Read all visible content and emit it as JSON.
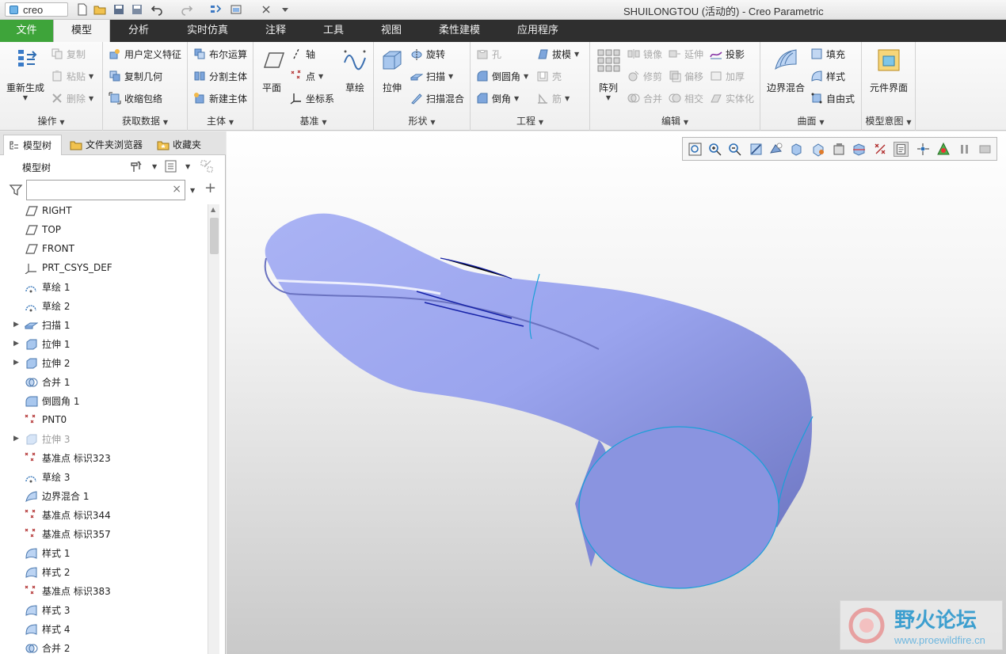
{
  "app": {
    "logo_text": "creo",
    "window_title": "SHUILONGTOU (活动的) - Creo Parametric"
  },
  "tabs": [
    {
      "label": "文件"
    },
    {
      "label": "模型"
    },
    {
      "label": "分析"
    },
    {
      "label": "实时仿真"
    },
    {
      "label": "注释"
    },
    {
      "label": "工具"
    },
    {
      "label": "视图"
    },
    {
      "label": "柔性建模"
    },
    {
      "label": "应用程序"
    }
  ],
  "ribbon": {
    "ops": {
      "label": "操作",
      "regen": "重新生成",
      "copy": "复制",
      "paste": "粘贴",
      "delete": "删除"
    },
    "getdata": {
      "label": "获取数据",
      "udf": "用户定义特征",
      "copygeom": "复制几何",
      "shrink": "收缩包络"
    },
    "body": {
      "label": "主体",
      "bool": "布尔运算",
      "split": "分割主体",
      "newbody": "新建主体"
    },
    "datum": {
      "label": "基准",
      "plane": "平面",
      "axis": "轴",
      "point": "点",
      "csys": "坐标系",
      "sketch": "草绘"
    },
    "shapes": {
      "label": "形状",
      "extrude": "拉伸",
      "revolve": "旋转",
      "sweep": "扫描",
      "sweepblend": "扫描混合"
    },
    "eng": {
      "label": "工程",
      "hole": "孔",
      "draft": "拔模",
      "round": "倒圆角",
      "shell": "壳",
      "chamfer": "倒角",
      "rib": "筋"
    },
    "edit": {
      "label": "编辑",
      "pattern": "阵列",
      "mirror": "镜像",
      "extend": "延伸",
      "project": "投影",
      "trim": "修剪",
      "offset": "偏移",
      "thicken": "加厚",
      "merge": "合并",
      "intersect": "相交",
      "solidify": "实体化"
    },
    "surf": {
      "label": "曲面",
      "boundary": "边界混合",
      "fill": "填充",
      "style": "样式",
      "freestyle": "自由式"
    },
    "intent": {
      "label": "模型意图",
      "component": "元件界面"
    }
  },
  "left": {
    "tabs": {
      "model_tree": "模型树",
      "folder": "文件夹浏览器",
      "favorites": "收藏夹"
    },
    "tree_title": "模型树",
    "search_value": "",
    "items": [
      {
        "label": "RIGHT",
        "icon": "datum-plane-icon"
      },
      {
        "label": "TOP",
        "icon": "datum-plane-icon"
      },
      {
        "label": "FRONT",
        "icon": "datum-plane-icon"
      },
      {
        "label": "PRT_CSYS_DEF",
        "icon": "csys-icon"
      },
      {
        "label": "草绘 1",
        "icon": "sketch-icon"
      },
      {
        "label": "草绘 2",
        "icon": "sketch-icon"
      },
      {
        "label": "扫描 1",
        "icon": "sweep-icon",
        "expandable": true
      },
      {
        "label": "拉伸 1",
        "icon": "extrude-icon",
        "expandable": true
      },
      {
        "label": "拉伸 2",
        "icon": "extrude-icon",
        "expandable": true
      },
      {
        "label": "合并 1",
        "icon": "merge-icon"
      },
      {
        "label": "倒圆角 1",
        "icon": "round-icon"
      },
      {
        "label": "PNT0",
        "icon": "datum-point-icon"
      },
      {
        "label": "拉伸 3",
        "icon": "extrude-icon",
        "expandable": true,
        "dim": true
      },
      {
        "label": "基准点 标识323",
        "icon": "datum-point-icon"
      },
      {
        "label": "草绘 3",
        "icon": "sketch-icon"
      },
      {
        "label": "边界混合 1",
        "icon": "boundary-blend-icon"
      },
      {
        "label": "基准点 标识344",
        "icon": "datum-point-icon"
      },
      {
        "label": "基准点 标识357",
        "icon": "datum-point-icon"
      },
      {
        "label": "样式 1",
        "icon": "style-icon"
      },
      {
        "label": "样式 2",
        "icon": "style-icon"
      },
      {
        "label": "基准点 标识383",
        "icon": "datum-point-icon"
      },
      {
        "label": "样式 3",
        "icon": "style-icon"
      },
      {
        "label": "样式 4",
        "icon": "style-icon"
      },
      {
        "label": "合并 2",
        "icon": "merge-icon"
      }
    ]
  },
  "watermark": {
    "title": "野火论坛",
    "url": "www.proewildfire.cn"
  },
  "colors": {
    "accent_green": "#3ea43a",
    "tab_bar": "#2f2f2f",
    "model_fill": "#9aa4ee",
    "edge": "#1a9fd8"
  }
}
